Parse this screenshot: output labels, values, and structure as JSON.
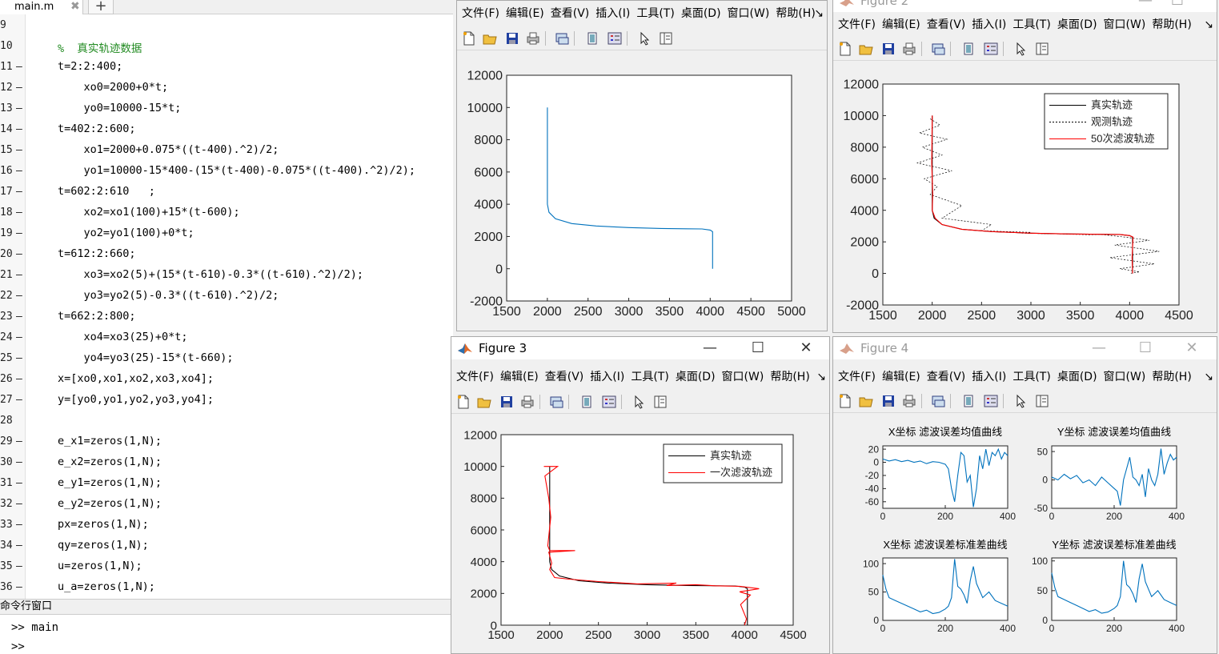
{
  "editor": {
    "tab_label": "main.m",
    "tab_close": "✖",
    "tab_add": "+",
    "lines": [
      {
        "n": "9",
        "dash": false,
        "text": "",
        "comment": false
      },
      {
        "n": "10",
        "dash": false,
        "text": "%  真实轨迹数据",
        "comment": true
      },
      {
        "n": "11",
        "dash": true,
        "text": "t=2:2:400;",
        "comment": false
      },
      {
        "n": "12",
        "dash": true,
        "text": "    xo0=2000+0*t;",
        "comment": false
      },
      {
        "n": "13",
        "dash": true,
        "text": "    yo0=10000-15*t;",
        "comment": false
      },
      {
        "n": "14",
        "dash": true,
        "text": "t=402:2:600;",
        "comment": false
      },
      {
        "n": "15",
        "dash": true,
        "text": "    xo1=2000+0.075*((t-400).^2)/2;",
        "comment": false
      },
      {
        "n": "16",
        "dash": true,
        "text": "    yo1=10000-15*400-(15*(t-400)-0.075*((t-400).^2)/2);",
        "comment": false
      },
      {
        "n": "17",
        "dash": true,
        "text": "t=602:2:610   ;",
        "comment": false
      },
      {
        "n": "18",
        "dash": true,
        "text": "    xo2=xo1(100)+15*(t-600);",
        "comment": false
      },
      {
        "n": "19",
        "dash": true,
        "text": "    yo2=yo1(100)+0*t;",
        "comment": false
      },
      {
        "n": "20",
        "dash": true,
        "text": "t=612:2:660;",
        "comment": false
      },
      {
        "n": "21",
        "dash": true,
        "text": "    xo3=xo2(5)+(15*(t-610)-0.3*((t-610).^2)/2);",
        "comment": false
      },
      {
        "n": "22",
        "dash": true,
        "text": "    yo3=yo2(5)-0.3*((t-610).^2)/2;",
        "comment": false
      },
      {
        "n": "23",
        "dash": true,
        "text": "t=662:2:800;",
        "comment": false
      },
      {
        "n": "24",
        "dash": true,
        "text": "    xo4=xo3(25)+0*t;",
        "comment": false
      },
      {
        "n": "25",
        "dash": true,
        "text": "    yo4=yo3(25)-15*(t-660);",
        "comment": false
      },
      {
        "n": "26",
        "dash": true,
        "text": "x=[xo0,xo1,xo2,xo3,xo4];",
        "comment": false
      },
      {
        "n": "27",
        "dash": true,
        "text": "y=[yo0,yo1,yo2,yo3,yo4];",
        "comment": false
      },
      {
        "n": "28",
        "dash": false,
        "text": "",
        "comment": false
      },
      {
        "n": "29",
        "dash": true,
        "text": "e_x1=zeros(1,N);",
        "comment": false
      },
      {
        "n": "30",
        "dash": true,
        "text": "e_x2=zeros(1,N);",
        "comment": false
      },
      {
        "n": "31",
        "dash": true,
        "text": "e_y1=zeros(1,N);",
        "comment": false
      },
      {
        "n": "32",
        "dash": true,
        "text": "e_y2=zeros(1,N);",
        "comment": false
      },
      {
        "n": "33",
        "dash": true,
        "text": "px=zeros(1,N);",
        "comment": false
      },
      {
        "n": "34",
        "dash": true,
        "text": "qy=zeros(1,N);",
        "comment": false
      },
      {
        "n": "35",
        "dash": true,
        "text": "u=zeros(1,N);",
        "comment": false
      },
      {
        "n": "36",
        "dash": true,
        "text": "u_a=zeros(1,N);",
        "comment": false
      }
    ]
  },
  "command_window": {
    "header": "命令行窗口",
    "prompt1": ">>",
    "input1": "main",
    "prompt2": ">>"
  },
  "menu_items": [
    "文件(F)",
    "编辑(E)",
    "查看(V)",
    "插入(I)",
    "工具(T)",
    "桌面(D)",
    "窗口(W)",
    "帮助(H)"
  ],
  "figure1": {
    "title": ""
  },
  "figure2": {
    "title": "Figure 2"
  },
  "figure3": {
    "title": "Figure 3"
  },
  "figure4": {
    "title": "Figure 4"
  },
  "colors": {
    "blue": "#0072BD",
    "red": "#FF0000",
    "black": "#000000",
    "comment_green": "#228B22"
  },
  "chart_data": [
    {
      "figure": "figure1",
      "type": "line",
      "xlim": [
        1500,
        5000
      ],
      "ylim": [
        -2000,
        12000
      ],
      "xticks": [
        1500,
        2000,
        2500,
        3000,
        3500,
        4000,
        4500,
        5000
      ],
      "yticks": [
        -2000,
        0,
        2000,
        4000,
        6000,
        8000,
        10000,
        12000
      ],
      "series": [
        {
          "color": "#0072BD",
          "x": [
            2000,
            2000,
            2020,
            2100,
            2300,
            2600,
            3000,
            3400,
            3700,
            3900,
            4000,
            4030,
            4030
          ],
          "y": [
            10000,
            4000,
            3500,
            3100,
            2800,
            2650,
            2550,
            2500,
            2480,
            2470,
            2400,
            2300,
            0
          ]
        }
      ]
    },
    {
      "figure": "figure2",
      "type": "line",
      "xlim": [
        1500,
        4500
      ],
      "ylim": [
        -2000,
        12000
      ],
      "xticks": [
        1500,
        2000,
        2500,
        3000,
        3500,
        4000,
        4500
      ],
      "yticks": [
        -2000,
        0,
        2000,
        4000,
        6000,
        8000,
        10000,
        12000
      ],
      "legend": [
        "真实轨迹",
        "观测轨迹",
        "50次滤波轨迹"
      ],
      "legend_placement": "top-right",
      "series": [
        {
          "name": "真实轨迹",
          "color": "#000000",
          "x": [
            2000,
            2000,
            2020,
            2100,
            2300,
            2600,
            3000,
            3400,
            3700,
            3900,
            4000,
            4030,
            4030
          ],
          "y": [
            10000,
            4000,
            3500,
            3100,
            2800,
            2650,
            2550,
            2500,
            2480,
            2470,
            2400,
            2300,
            0
          ]
        },
        {
          "name": "观测轨迹",
          "color": "#000000",
          "dashed": true,
          "x": [
            1980,
            2080,
            1870,
            2150,
            1900,
            2100,
            1850,
            2200,
            1920,
            2050,
            1980,
            2300,
            2100,
            2600,
            2500,
            3000,
            2900,
            3300,
            3200,
            3600,
            3700,
            3950,
            4200,
            3850,
            4300,
            3800,
            4250,
            3900,
            4100,
            4000
          ],
          "y": [
            9800,
            9400,
            8900,
            8500,
            8000,
            7500,
            7000,
            6500,
            6000,
            5500,
            5000,
            4300,
            3500,
            3100,
            2700,
            2600,
            2550,
            2500,
            2520,
            2450,
            2480,
            2300,
            2100,
            1800,
            1400,
            1000,
            600,
            300,
            100,
            0
          ]
        },
        {
          "name": "50次滤波轨迹",
          "color": "#FF0000",
          "x": [
            2000,
            1995,
            2005,
            2000,
            2030,
            2100,
            2300,
            2600,
            3000,
            3400,
            3700,
            3900,
            4000,
            4035,
            4025,
            4030
          ],
          "y": [
            10000,
            7000,
            5000,
            4000,
            3500,
            3100,
            2800,
            2650,
            2550,
            2500,
            2480,
            2470,
            2400,
            2300,
            1000,
            0
          ]
        }
      ]
    },
    {
      "figure": "figure3",
      "type": "line",
      "xlim": [
        1500,
        4500
      ],
      "ylim": [
        0,
        12000
      ],
      "xticks": [
        1500,
        2000,
        2500,
        3000,
        3500,
        4000,
        4500
      ],
      "yticks": [
        0,
        2000,
        4000,
        6000,
        8000,
        10000,
        12000
      ],
      "legend": [
        "真实轨迹",
        "一次滤波轨迹"
      ],
      "legend_placement": "top-right",
      "series": [
        {
          "name": "真实轨迹",
          "color": "#000000",
          "x": [
            2000,
            2000,
            2020,
            2100,
            2300,
            2600,
            3000,
            3400,
            3700,
            3900,
            4000,
            4030,
            4030
          ],
          "y": [
            10000,
            4000,
            3500,
            3100,
            2800,
            2650,
            2550,
            2500,
            2480,
            2470,
            2400,
            2300,
            0
          ]
        },
        {
          "name": "一次滤波轨迹",
          "color": "#FF0000",
          "x": [
            1940,
            2080,
            1950,
            1990,
            2010,
            1980,
            2000,
            2260,
            1990,
            2020,
            2000,
            2050,
            2200,
            2500,
            2900,
            3300,
            3200,
            3500,
            3700,
            3950,
            4150,
            3950,
            4060,
            3960,
            4020,
            4000
          ],
          "y": [
            10000,
            10000,
            9400,
            8000,
            6800,
            5000,
            4700,
            4700,
            4600,
            3900,
            3500,
            3000,
            2900,
            2750,
            2600,
            2650,
            2500,
            2550,
            2480,
            2450,
            2300,
            2100,
            1900,
            1300,
            400,
            0
          ]
        }
      ]
    },
    {
      "figure": "figure4",
      "type": "line",
      "title": "X坐标 滤波误差均值曲线",
      "xlim": [
        0,
        400
      ],
      "ylim": [
        -70,
        25
      ],
      "xticks": [
        0,
        200,
        400
      ],
      "yticks": [
        -60,
        -40,
        -20,
        0,
        20
      ],
      "series": [
        {
          "color": "#0072BD",
          "x": [
            0,
            20,
            40,
            60,
            80,
            100,
            120,
            140,
            160,
            180,
            200,
            210,
            220,
            230,
            240,
            250,
            260,
            270,
            280,
            290,
            300,
            310,
            320,
            330,
            340,
            350,
            360,
            370,
            380,
            390,
            400
          ],
          "y": [
            5,
            2,
            4,
            1,
            3,
            0,
            2,
            -2,
            1,
            0,
            -3,
            -10,
            -40,
            -60,
            -20,
            15,
            10,
            -30,
            -20,
            -68,
            -40,
            10,
            -10,
            20,
            -5,
            15,
            10,
            20,
            5,
            15,
            10
          ]
        }
      ]
    },
    {
      "figure": "figure4",
      "type": "line",
      "title": "Y坐标 滤波误差均值曲线",
      "xlim": [
        0,
        400
      ],
      "ylim": [
        -50,
        60
      ],
      "xticks": [
        0,
        200,
        400
      ],
      "yticks": [
        -50,
        0,
        50
      ],
      "series": [
        {
          "color": "#0072BD",
          "x": [
            0,
            20,
            40,
            60,
            80,
            100,
            120,
            140,
            160,
            180,
            200,
            210,
            220,
            230,
            240,
            250,
            260,
            270,
            280,
            290,
            300,
            310,
            320,
            330,
            340,
            350,
            360,
            370,
            380,
            390,
            400
          ],
          "y": [
            5,
            0,
            10,
            2,
            8,
            -5,
            0,
            -10,
            5,
            -5,
            -15,
            -20,
            -45,
            0,
            20,
            40,
            5,
            0,
            -10,
            10,
            -30,
            20,
            0,
            -10,
            10,
            55,
            10,
            30,
            45,
            35,
            40
          ]
        }
      ]
    },
    {
      "figure": "figure4",
      "type": "line",
      "title": "X坐标 滤波误差标准差曲线",
      "xlim": [
        0,
        400
      ],
      "ylim": [
        0,
        110
      ],
      "xticks": [
        0,
        200,
        400
      ],
      "yticks": [
        0,
        50,
        100
      ],
      "series": [
        {
          "color": "#0072BD",
          "x": [
            0,
            10,
            20,
            40,
            60,
            80,
            100,
            120,
            140,
            160,
            180,
            200,
            210,
            220,
            230,
            240,
            250,
            260,
            270,
            280,
            290,
            300,
            320,
            340,
            360,
            380,
            400
          ],
          "y": [
            80,
            55,
            40,
            35,
            30,
            25,
            20,
            15,
            18,
            12,
            14,
            20,
            25,
            40,
            108,
            60,
            55,
            45,
            30,
            70,
            95,
            65,
            40,
            50,
            35,
            30,
            25
          ]
        }
      ]
    },
    {
      "figure": "figure4",
      "type": "line",
      "title": "Y坐标 滤波误差标准差曲线",
      "xlim": [
        0,
        400
      ],
      "ylim": [
        0,
        105
      ],
      "xticks": [
        0,
        200,
        400
      ],
      "yticks": [
        0,
        50,
        100
      ],
      "series": [
        {
          "color": "#0072BD",
          "x": [
            0,
            10,
            20,
            40,
            60,
            80,
            100,
            120,
            140,
            160,
            180,
            200,
            210,
            220,
            230,
            240,
            250,
            260,
            270,
            280,
            290,
            300,
            320,
            340,
            360,
            380,
            400
          ],
          "y": [
            80,
            55,
            40,
            35,
            30,
            25,
            20,
            15,
            18,
            12,
            14,
            20,
            25,
            40,
            100,
            60,
            55,
            45,
            30,
            70,
            95,
            65,
            40,
            50,
            35,
            30,
            25
          ]
        }
      ]
    }
  ]
}
